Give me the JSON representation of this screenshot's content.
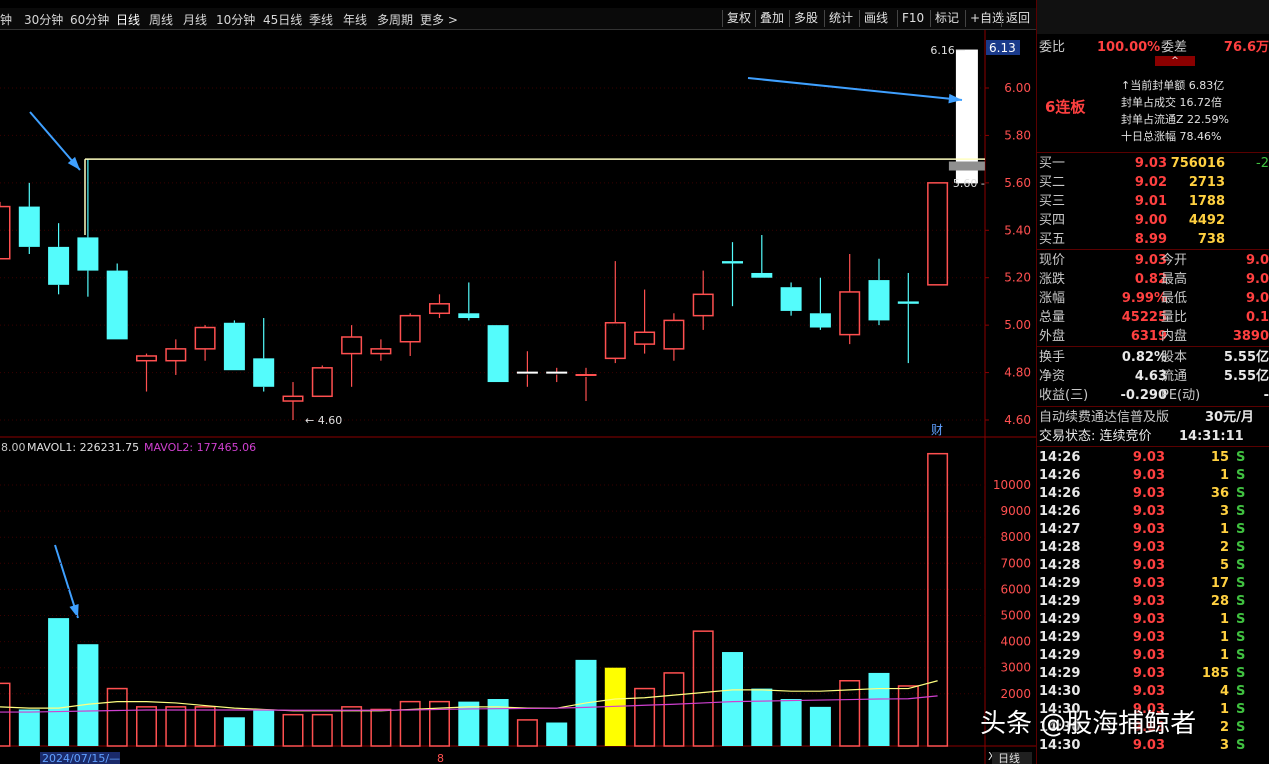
{
  "toolbar": {
    "periods": [
      "钟",
      "30分钟",
      "60分钟",
      "日线",
      "周线",
      "月线",
      "10分钟",
      "45日线",
      "季线",
      "年线",
      "多周期",
      "更多 >"
    ],
    "buttons": [
      "复权",
      "叠加",
      "多股",
      "统计",
      "画线",
      "F10",
      "标记",
      "+自选",
      "返回"
    ]
  },
  "chart_data": {
    "type": "candlestick",
    "period": "日线",
    "ylim": [
      4.5,
      6.2
    ],
    "yticks": [
      "6.00",
      "5.80",
      "5.60",
      "5.40",
      "5.20",
      "5.00",
      "4.80",
      "4.60"
    ],
    "current_price_tag": "6.13",
    "high_label": "6.16",
    "prev_label": "5.60",
    "low_label": "4.60",
    "fin_tag": "财",
    "candles": [
      {
        "o": 5.28,
        "c": 5.5,
        "h": 5.52,
        "l": 5.28
      },
      {
        "o": 5.5,
        "c": 5.33,
        "h": 5.6,
        "l": 5.3
      },
      {
        "o": 5.33,
        "c": 5.17,
        "h": 5.43,
        "l": 5.13
      },
      {
        "o": 5.37,
        "c": 5.23,
        "h": 5.7,
        "l": 5.12
      },
      {
        "o": 5.23,
        "c": 4.94,
        "h": 5.26,
        "l": 4.94
      },
      {
        "o": 4.85,
        "c": 4.87,
        "h": 4.88,
        "l": 4.72
      },
      {
        "o": 4.85,
        "c": 4.9,
        "h": 4.94,
        "l": 4.79
      },
      {
        "o": 4.9,
        "c": 4.99,
        "h": 5.0,
        "l": 4.85
      },
      {
        "o": 5.01,
        "c": 4.81,
        "h": 5.02,
        "l": 4.81
      },
      {
        "o": 4.86,
        "c": 4.74,
        "h": 5.03,
        "l": 4.72
      },
      {
        "o": 4.68,
        "c": 4.7,
        "h": 4.76,
        "l": 4.6
      },
      {
        "o": 4.7,
        "c": 4.82,
        "h": 4.83,
        "l": 4.7
      },
      {
        "o": 4.88,
        "c": 4.95,
        "h": 5.0,
        "l": 4.74
      },
      {
        "o": 4.88,
        "c": 4.9,
        "h": 4.94,
        "l": 4.85
      },
      {
        "o": 4.93,
        "c": 5.04,
        "h": 5.05,
        "l": 4.87
      },
      {
        "o": 5.05,
        "c": 5.09,
        "h": 5.13,
        "l": 5.03
      },
      {
        "o": 5.05,
        "c": 5.03,
        "h": 5.18,
        "l": 5.02
      },
      {
        "o": 5.0,
        "c": 4.76,
        "h": 5.0,
        "l": 4.76
      },
      {
        "o": 4.8,
        "c": 4.8,
        "h": 4.89,
        "l": 4.74
      },
      {
        "o": 4.8,
        "c": 4.8,
        "h": 4.82,
        "l": 4.76
      },
      {
        "o": 4.79,
        "c": 4.79,
        "h": 4.82,
        "l": 4.68
      },
      {
        "o": 4.86,
        "c": 5.01,
        "h": 5.27,
        "l": 4.84
      },
      {
        "o": 4.92,
        "c": 4.97,
        "h": 5.15,
        "l": 4.88
      },
      {
        "o": 4.9,
        "c": 5.02,
        "h": 5.05,
        "l": 4.85
      },
      {
        "o": 5.04,
        "c": 5.13,
        "h": 5.23,
        "l": 4.98
      },
      {
        "o": 5.27,
        "c": 5.26,
        "h": 5.35,
        "l": 5.08
      },
      {
        "o": 5.22,
        "c": 5.2,
        "h": 5.38,
        "l": 5.2
      },
      {
        "o": 5.16,
        "c": 5.06,
        "h": 5.18,
        "l": 5.04
      },
      {
        "o": 5.05,
        "c": 4.99,
        "h": 5.2,
        "l": 4.98
      },
      {
        "o": 4.96,
        "c": 5.14,
        "h": 5.3,
        "l": 4.92
      },
      {
        "o": 5.19,
        "c": 5.02,
        "h": 5.28,
        "l": 5.0
      },
      {
        "o": 5.1,
        "c": 5.09,
        "h": 5.22,
        "l": 4.84
      },
      {
        "o": 5.17,
        "c": 5.6,
        "h": 5.6,
        "l": 5.17
      }
    ],
    "limit_up_candle": {
      "o": 5.6,
      "c": 6.16,
      "h": 6.16,
      "l": 5.6
    },
    "hline_price": 5.7,
    "volume": {
      "legend_prefix": "8.00",
      "mavol1_label": "MAVOL1: 226231.75",
      "mavol2_label": "MAVOL2: 177465.06",
      "ylim": [
        0,
        11000
      ],
      "yticks": [
        "10000",
        "9000",
        "8000",
        "7000",
        "6000",
        "5000",
        "4000",
        "3000",
        "2000"
      ],
      "unit": "X100",
      "bars": [
        2400,
        1400,
        4900,
        3900,
        2200,
        1500,
        1500,
        1500,
        1100,
        1400,
        1200,
        1200,
        1500,
        1400,
        1700,
        1700,
        1700,
        1800,
        1000,
        900,
        3300,
        3000,
        2200,
        2800,
        4400,
        3600,
        2200,
        1800,
        1500,
        2500,
        2800,
        2300,
        11200
      ],
      "bar_colors": [
        "r",
        "c",
        "c",
        "c",
        "r",
        "r",
        "r",
        "r",
        "c",
        "c",
        "r",
        "r",
        "r",
        "r",
        "r",
        "r",
        "c",
        "c",
        "r",
        "c",
        "c",
        "y",
        "r",
        "r",
        "r",
        "c",
        "c",
        "c",
        "c",
        "r",
        "c",
        "r",
        "r"
      ]
    },
    "date_label": "2024/07/15/—",
    "month_mark": "8",
    "period_tag": "日线"
  },
  "colors": {
    "up": "#ff5050",
    "down": "#54fcfc",
    "text_red": "#ff4040",
    "yellow": "#ffff00",
    "arrow": "#3fa0ff"
  },
  "right_panel": {
    "weibi_label": "委比",
    "weibi_value": "100.00%",
    "weicha_label": "委差",
    "weicha_value": "76.6万",
    "board_tag": "6连板",
    "seal_amount": "↑当前封单额 6.83亿",
    "seal_turnover": "封单占成交 16.72倍",
    "seal_float": "封单占流通Z 22.59%",
    "ten_day": "十日总涨幅 78.46%",
    "bids": [
      {
        "label": "买一",
        "price": "9.03",
        "vol": "756016",
        "extra": "-2"
      },
      {
        "label": "买二",
        "price": "9.02",
        "vol": "2713",
        "extra": ""
      },
      {
        "label": "买三",
        "price": "9.01",
        "vol": "1788",
        "extra": ""
      },
      {
        "label": "买四",
        "price": "9.00",
        "vol": "4492",
        "extra": ""
      },
      {
        "label": "买五",
        "price": "8.99",
        "vol": "738",
        "extra": ""
      }
    ],
    "quote": [
      {
        "l1": "现价",
        "v1": "9.03",
        "l2": "今开",
        "v2": "9.0"
      },
      {
        "l1": "涨跌",
        "v1": "0.82",
        "l2": "最高",
        "v2": "9.0"
      },
      {
        "l1": "涨幅",
        "v1": "9.99%",
        "l2": "最低",
        "v2": "9.0"
      },
      {
        "l1": "总量",
        "v1": "45225",
        "l2": "量比",
        "v2": "0.1"
      },
      {
        "l1": "外盘",
        "v1": "6319",
        "l2": "内盘",
        "v2": "3890"
      }
    ],
    "stats": [
      {
        "l1": "换手",
        "v1": "0.82%",
        "l2": "股本",
        "v2": "5.55亿"
      },
      {
        "l1": "净资",
        "v1": "4.63",
        "l2": "流通",
        "v2": "5.55亿"
      },
      {
        "l1": "收益(三)",
        "v1": "-0.290",
        "l2": "PE(动)",
        "v2": "-"
      }
    ],
    "ad_text": "自动续费通达信普及版",
    "ad_price": "30元/月",
    "trade_status": "交易状态: 连续竞价",
    "trade_time": "14:31:11",
    "ticks": [
      {
        "t": "14:26",
        "p": "9.03",
        "v": "15",
        "s": "S"
      },
      {
        "t": "14:26",
        "p": "9.03",
        "v": "1",
        "s": "S"
      },
      {
        "t": "14:26",
        "p": "9.03",
        "v": "36",
        "s": "S"
      },
      {
        "t": "14:26",
        "p": "9.03",
        "v": "3",
        "s": "S"
      },
      {
        "t": "14:27",
        "p": "9.03",
        "v": "1",
        "s": "S"
      },
      {
        "t": "14:28",
        "p": "9.03",
        "v": "2",
        "s": "S"
      },
      {
        "t": "14:28",
        "p": "9.03",
        "v": "5",
        "s": "S"
      },
      {
        "t": "14:29",
        "p": "9.03",
        "v": "17",
        "s": "S"
      },
      {
        "t": "14:29",
        "p": "9.03",
        "v": "28",
        "s": "S"
      },
      {
        "t": "14:29",
        "p": "9.03",
        "v": "1",
        "s": "S"
      },
      {
        "t": "14:29",
        "p": "9.03",
        "v": "1",
        "s": "S"
      },
      {
        "t": "14:29",
        "p": "9.03",
        "v": "1",
        "s": "S"
      },
      {
        "t": "14:29",
        "p": "9.03",
        "v": "185",
        "s": "S"
      },
      {
        "t": "14:30",
        "p": "9.03",
        "v": "4",
        "s": "S"
      },
      {
        "t": "14:30",
        "p": "9.03",
        "v": "1",
        "s": "S"
      },
      {
        "t": "14:30",
        "p": "9.03",
        "v": "2",
        "s": "S"
      },
      {
        "t": "14:30",
        "p": "9.03",
        "v": "3",
        "s": "S"
      }
    ]
  },
  "watermark": "头条 @股海捕鲸者"
}
